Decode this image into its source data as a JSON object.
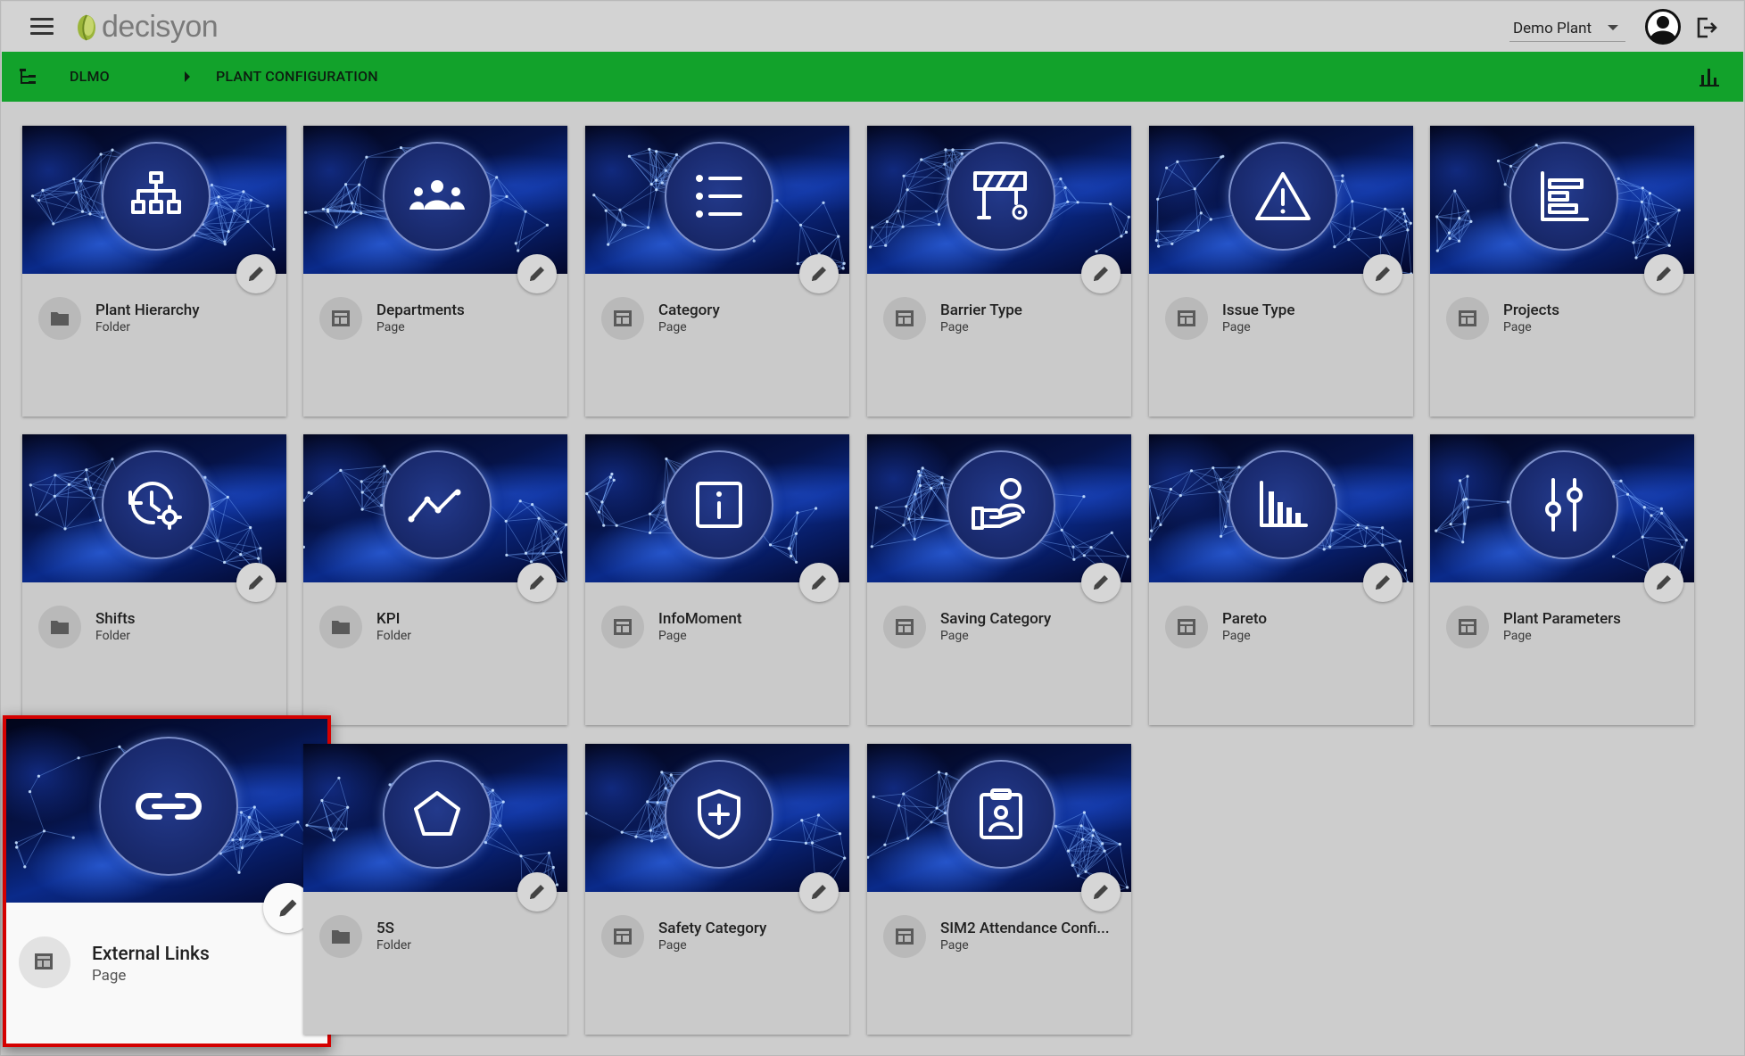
{
  "app": {
    "logo_text": "decisyon",
    "plant_select": "Demo Plant"
  },
  "breadcrumb": {
    "items": [
      "DLMO",
      "PLANT CONFIGURATION"
    ]
  },
  "colors": {
    "header_green": "#12a22b",
    "highlight_border": "#d40000"
  },
  "cards": [
    {
      "title": "Plant Hierarchy",
      "type": "Folder",
      "icon": "hierarchy-icon"
    },
    {
      "title": "Departments",
      "type": "Page",
      "icon": "people-group-icon"
    },
    {
      "title": "Category",
      "type": "Page",
      "icon": "list-icon"
    },
    {
      "title": "Barrier Type",
      "type": "Page",
      "icon": "barrier-icon"
    },
    {
      "title": "Issue Type",
      "type": "Page",
      "icon": "warning-icon"
    },
    {
      "title": "Projects",
      "type": "Page",
      "icon": "gantt-icon"
    },
    {
      "title": "Shifts",
      "type": "Folder",
      "icon": "history-settings-icon"
    },
    {
      "title": "KPI",
      "type": "Folder",
      "icon": "trend-line-icon"
    },
    {
      "title": "InfoMoment",
      "type": "Page",
      "icon": "info-box-icon"
    },
    {
      "title": "Saving Category",
      "type": "Page",
      "icon": "hand-person-icon"
    },
    {
      "title": "Pareto",
      "type": "Page",
      "icon": "bar-chart-icon"
    },
    {
      "title": "Plant Parameters",
      "type": "Page",
      "icon": "sliders-icon"
    },
    {
      "title": "External Links",
      "type": "Page",
      "icon": "link-icon"
    },
    {
      "title": "5S",
      "type": "Folder",
      "icon": "pentagon-icon"
    },
    {
      "title": "Safety Category",
      "type": "Page",
      "icon": "shield-plus-icon"
    },
    {
      "title": "SIM2 Attendance Confi...",
      "type": "Page",
      "icon": "clipboard-person-icon"
    }
  ]
}
